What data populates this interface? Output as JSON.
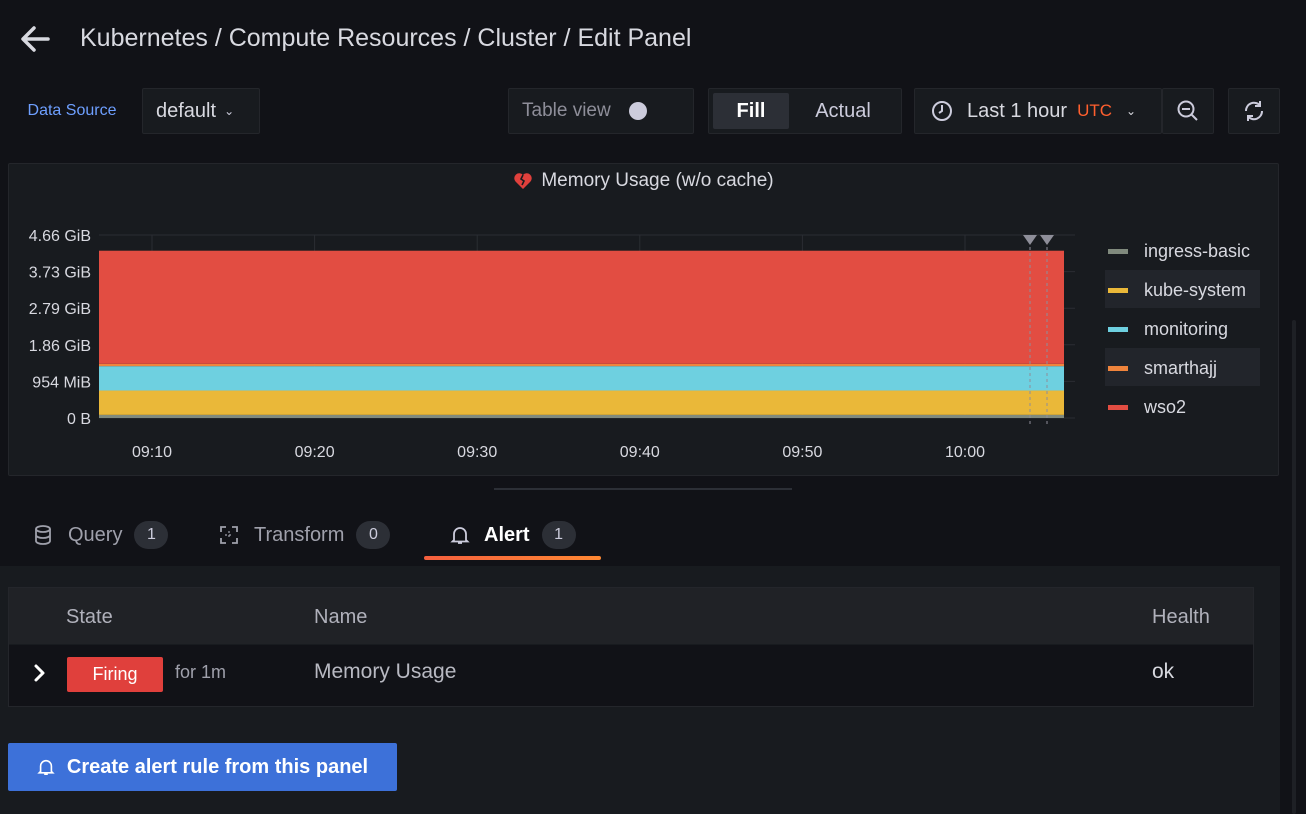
{
  "header": {
    "breadcrumb": "Kubernetes / Compute Resources / Cluster / Edit Panel"
  },
  "toolbar": {
    "data_source_label": "Data Source",
    "data_source_value": "default",
    "table_view_label": "Table view",
    "fill_label": "Fill",
    "actual_label": "Actual",
    "time_range": "Last 1 hour",
    "timezone": "UTC"
  },
  "panel": {
    "title": "Memory Usage (w/o cache)"
  },
  "chart_data": {
    "type": "area",
    "title": "Memory Usage (w/o cache)",
    "y_ticks": [
      "4.66 GiB",
      "3.73 GiB",
      "2.79 GiB",
      "1.86 GiB",
      "954 MiB",
      "0 B"
    ],
    "x_ticks": [
      "09:10",
      "09:20",
      "09:30",
      "09:40",
      "09:50",
      "10:00"
    ],
    "ylim_gib": [
      0,
      4.66
    ],
    "stacked": true,
    "series": [
      {
        "name": "ingress-basic",
        "color": "#808a7d",
        "value_gib": 0.08
      },
      {
        "name": "kube-system",
        "color": "#eab839",
        "value_gib": 0.62
      },
      {
        "name": "monitoring",
        "color": "#6ed0e0",
        "value_gib": 0.62
      },
      {
        "name": "smarthajj",
        "color": "#ef843c",
        "value_gib": 0.06
      },
      {
        "name": "wso2",
        "color": "#e24d42",
        "value_gib": 2.88
      }
    ],
    "legend_position": "right"
  },
  "tabs": [
    {
      "label": "Query",
      "count": "1"
    },
    {
      "label": "Transform",
      "count": "0"
    },
    {
      "label": "Alert",
      "count": "1"
    }
  ],
  "alert_table": {
    "headers": {
      "state": "State",
      "name": "Name",
      "health": "Health"
    },
    "rows": [
      {
        "state": "Firing",
        "duration": "for 1m",
        "name": "Memory Usage",
        "health": "ok"
      }
    ]
  },
  "create_button_label": "Create alert rule from this panel"
}
